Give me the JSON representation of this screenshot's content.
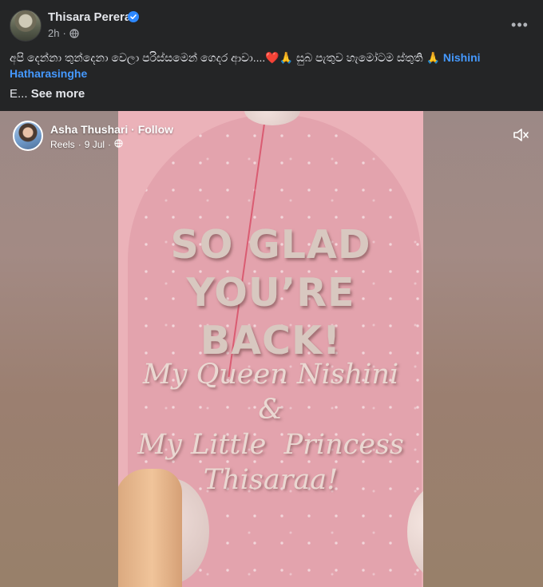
{
  "post": {
    "author": "Thisara Perera",
    "time": "2h",
    "body_text": "අපි දෙන්නා තුන්දෙනා වෙලා පරිස්සමෙන් ගෙදර ආවා....❤️🙏 සුබ පැතුව හැමෝටම ස්තුති 🙏",
    "mention": "Nishini Hatharasinghe",
    "truncated_prefix": "E...",
    "see_more_label": "See more"
  },
  "reel": {
    "author": "Asha Thushari",
    "follow_label": "· Follow",
    "source": "Reels",
    "date": "9 Jul",
    "headline_line1": "SO GLAD",
    "headline_line2": "YOU’RE BACK!",
    "script_line1": "My Queen Nishini",
    "script_line2": "&",
    "script_line3": "My Little  Princess",
    "script_line4": "Thisaraa!"
  },
  "icons": {
    "verified": "verified-badge-icon",
    "privacy": "globe-icon",
    "more": "more-options-icon",
    "mute": "speaker-muted-icon"
  },
  "colors": {
    "background": "#242526",
    "text_primary": "#e4e6eb",
    "text_secondary": "#b0b3b8",
    "link": "#4599ff",
    "verified": "#2d88ff"
  }
}
